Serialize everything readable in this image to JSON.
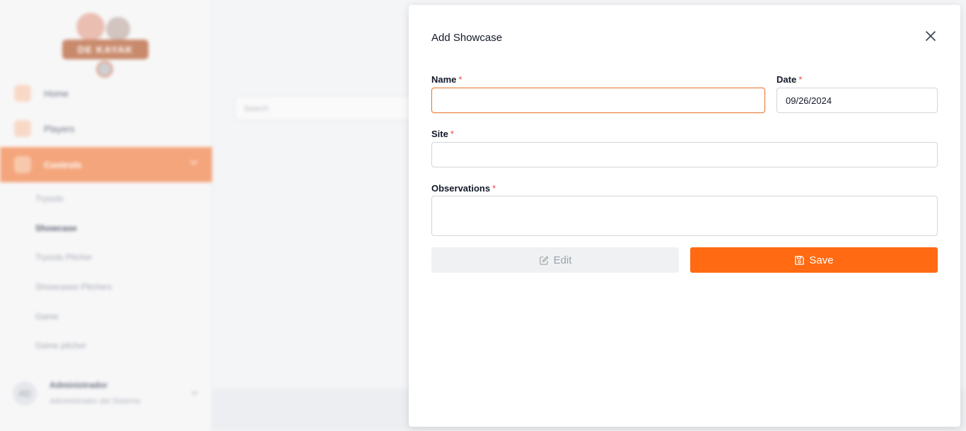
{
  "background": {
    "logo_text": "DE KAYAK",
    "nav": [
      {
        "label": "Home"
      },
      {
        "label": "Players"
      },
      {
        "label": "Controls",
        "active": true
      }
    ],
    "submenu": [
      {
        "label": "Tryouts"
      },
      {
        "label": "Showcase",
        "selected": true
      },
      {
        "label": "Tryouts Pitcher"
      },
      {
        "label": "Showcases Pitchers"
      },
      {
        "label": "Game"
      },
      {
        "label": "Game pitcher"
      }
    ],
    "user": {
      "initials": "AD",
      "name": "Administrador",
      "role": "Administrador del Sistema"
    },
    "search_placeholder": "Search"
  },
  "modal": {
    "title": "Add Showcase",
    "required_mark": "*",
    "fields": {
      "name": {
        "label": "Name",
        "value": ""
      },
      "date": {
        "label": "Date",
        "value": "09/26/2024"
      },
      "site": {
        "label": "Site",
        "value": ""
      },
      "observations": {
        "label": "Observations",
        "value": ""
      }
    },
    "buttons": {
      "edit": {
        "label": "Edit",
        "icon": "pencil-square-icon",
        "disabled": true
      },
      "save": {
        "label": "Save",
        "icon": "floppy-disk-icon"
      }
    },
    "colors": {
      "accent": "#ff6a13",
      "required": "#ef4444",
      "focus_border": "#e67e3a"
    }
  }
}
